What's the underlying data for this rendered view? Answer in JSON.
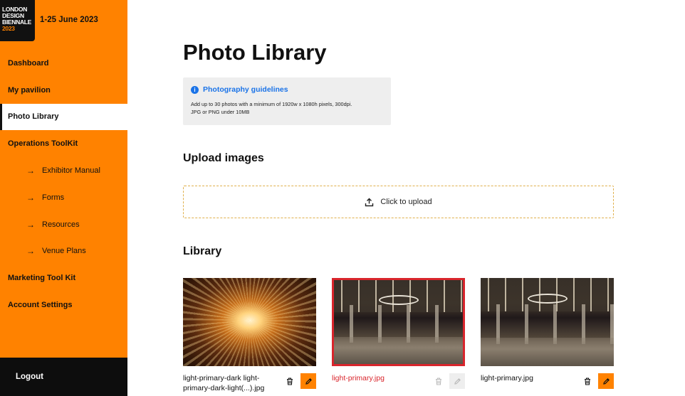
{
  "brand": {
    "logo_lines": [
      "LONDON",
      "DESIGN",
      "BIENNALE",
      "2023"
    ],
    "dates": "1-25 June 2023"
  },
  "sidebar": {
    "items": [
      {
        "label": "Dashboard",
        "level": 0,
        "active": false
      },
      {
        "label": "My pavilion",
        "level": 0,
        "active": false
      },
      {
        "label": "Photo Library",
        "level": 0,
        "active": true
      },
      {
        "label": "Operations ToolKit",
        "level": 0,
        "active": false
      },
      {
        "label": "Exhibitor Manual",
        "level": 1,
        "active": false
      },
      {
        "label": "Forms",
        "level": 1,
        "active": false
      },
      {
        "label": "Resources",
        "level": 1,
        "active": false
      },
      {
        "label": "Venue Plans",
        "level": 1,
        "active": false
      },
      {
        "label": "Marketing Tool Kit",
        "level": 0,
        "active": false
      },
      {
        "label": "Account Settings",
        "level": 0,
        "active": false
      }
    ],
    "logout_label": "Logout",
    "sub_arrow": "→"
  },
  "main": {
    "title": "Photo Library",
    "guidelines": {
      "heading": "Photography guidelines",
      "icon": "info-icon",
      "text_line1": "Add up to 30 photos with a minimum of 1920w x 1080h pixels, 300dpi.",
      "text_line2": "JPG or PNG under 10MB"
    },
    "upload": {
      "heading": "Upload images",
      "label": "Click to upload",
      "icon": "upload-icon"
    },
    "library": {
      "heading": "Library",
      "photos": [
        {
          "filename_line1": "light-primary-dark light-",
          "filename_line2": "primary-dark-light(...).jpg",
          "selected": false,
          "error": false,
          "disabled": false
        },
        {
          "filename_line1": "light-primary.jpg",
          "filename_line2": "",
          "selected": true,
          "error": true,
          "disabled": true
        },
        {
          "filename_line1": "light-primary.jpg",
          "filename_line2": "",
          "selected": false,
          "error": false,
          "disabled": false
        }
      ]
    }
  },
  "colors": {
    "brand_orange": "#ff8200",
    "error_red": "#d9252c",
    "link_blue": "#1a73e8",
    "sidebar_dark": "#0d0d0d"
  }
}
